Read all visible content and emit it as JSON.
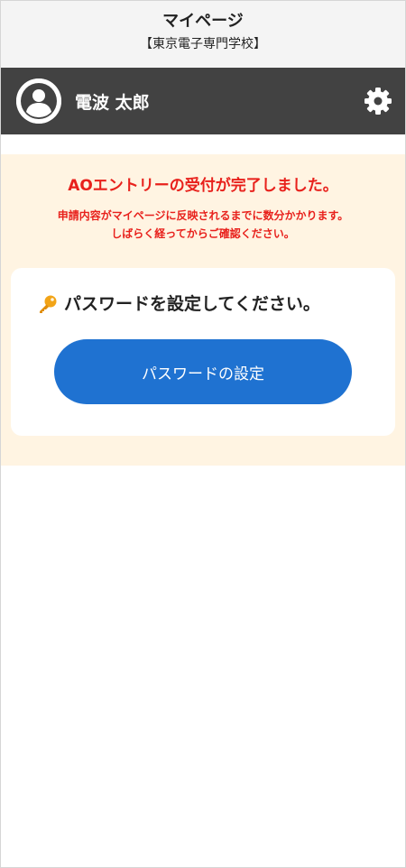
{
  "header": {
    "title": "マイページ",
    "subtitle": "【東京電子専門学校】"
  },
  "user": {
    "name": "電波 太郎",
    "avatar_icon": "user-avatar-icon",
    "settings_icon": "gear-icon"
  },
  "notice": {
    "headline": "AOエントリーの受付が完了しました。",
    "detail_line1": "申請内容がマイページに反映されるまでに数分かかります。",
    "detail_line2": "しばらく経ってからご確認ください。",
    "text_color": "#e8211c",
    "background_color": "#fff4e2"
  },
  "password_card": {
    "icon": "key-icon",
    "prompt": "パスワードを設定してください。",
    "button_label": "パスワードの設定",
    "button_color": "#1f72d1"
  },
  "colors": {
    "header_bg": "#f4f4f4",
    "userbar_bg": "#424242"
  }
}
